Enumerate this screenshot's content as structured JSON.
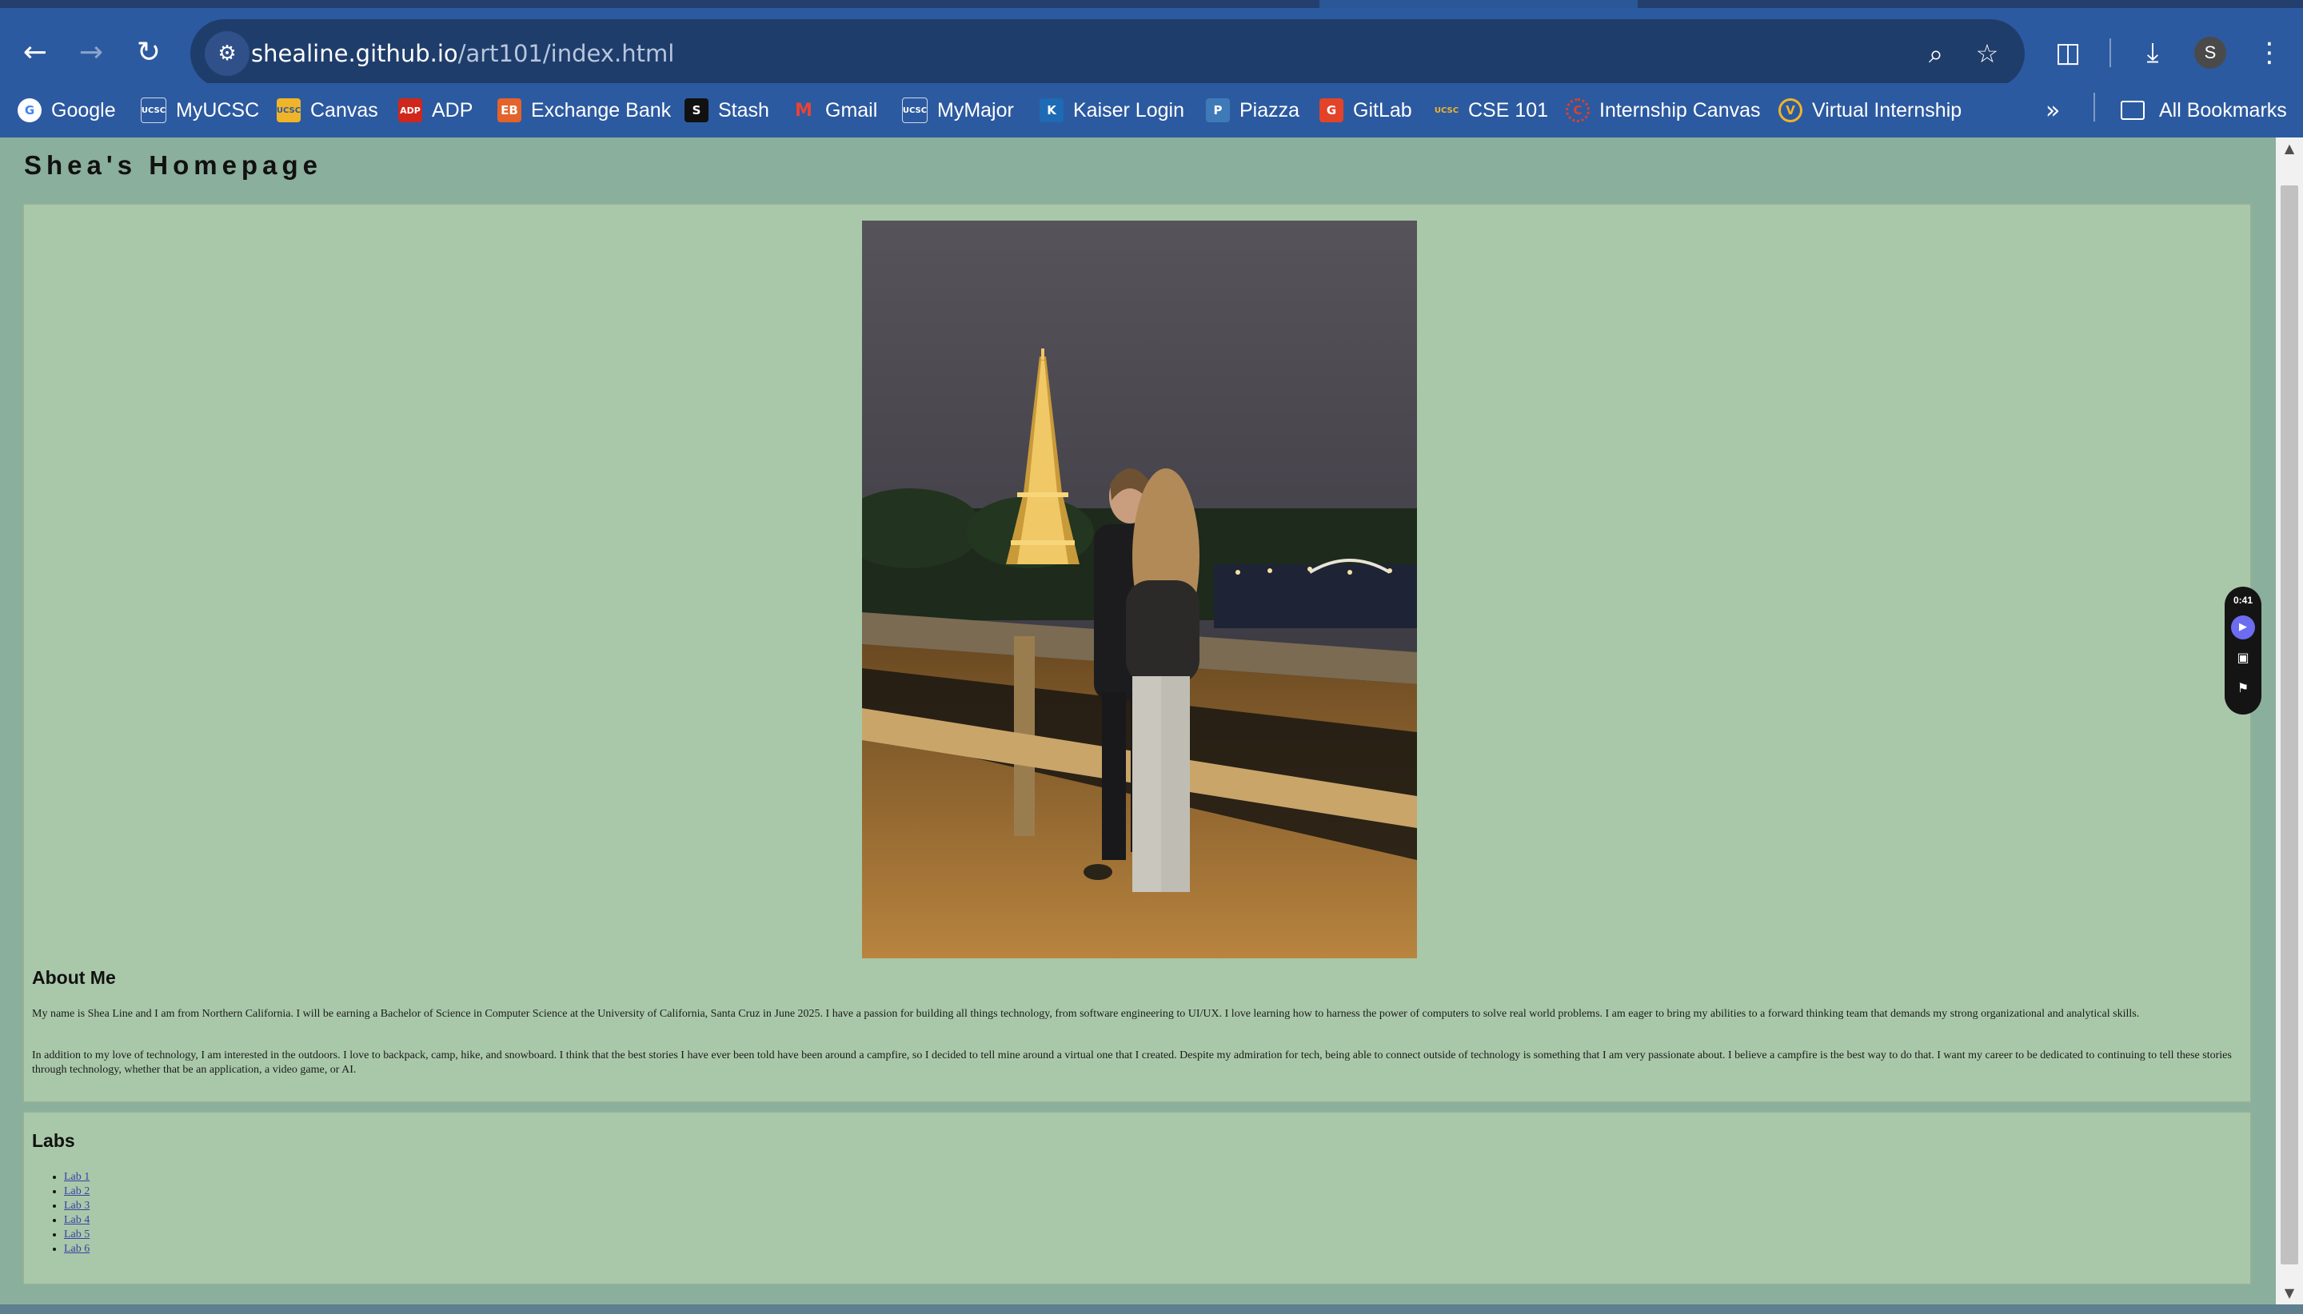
{
  "browser": {
    "back_icon": "arrow-left-icon",
    "forward_icon": "arrow-right-icon",
    "reload_icon": "reload-icon",
    "url_host": "shealine.github.io",
    "url_path": "/art101/index.html",
    "profile_initial": "S",
    "colors": {
      "toolbar": "#2c5aa0",
      "omnibox": "#1f3d6b"
    }
  },
  "bookmarks": {
    "items": [
      {
        "label": "Google",
        "icon": "google-icon",
        "glyph": "G",
        "color": "#ffffff"
      },
      {
        "label": "MyUCSC",
        "icon": "ucsc-icon",
        "glyph": "UCSC",
        "color": "#2c5aa0"
      },
      {
        "label": "Canvas",
        "icon": "ucsc-gold-icon",
        "glyph": "UCSC",
        "color": "#f0b429"
      },
      {
        "label": "ADP",
        "icon": "adp-icon",
        "glyph": "ADP",
        "color": "#d0271d"
      },
      {
        "label": "Exchange Bank",
        "icon": "exchange-bank-icon",
        "glyph": "EB",
        "color": "#e4632b"
      },
      {
        "label": "Stash",
        "icon": "stash-icon",
        "glyph": "S",
        "color": "#111111"
      },
      {
        "label": "Gmail",
        "icon": "gmail-icon",
        "glyph": "M",
        "color": "#ea4335"
      },
      {
        "label": "MyMajor",
        "icon": "ucsc-icon",
        "glyph": "UCSC",
        "color": "#2c5aa0"
      },
      {
        "label": "Kaiser Login",
        "icon": "kaiser-icon",
        "glyph": "K",
        "color": "#1e6ab5"
      },
      {
        "label": "Piazza",
        "icon": "piazza-icon",
        "glyph": "P",
        "color": "#3e7ab8"
      },
      {
        "label": "GitLab",
        "icon": "gitlab-icon",
        "glyph": "G",
        "color": "#e24329"
      },
      {
        "label": "CSE 101",
        "icon": "ucsc-gold-icon",
        "glyph": "UCSC",
        "color": "#c99a2e"
      },
      {
        "label": "Internship Canvas",
        "icon": "canvas-icon",
        "glyph": "C",
        "color": "#e13f2b"
      },
      {
        "label": "Virtual Internship",
        "icon": "virtual-internship-icon",
        "glyph": "V",
        "color": "#f0b429"
      }
    ],
    "overflow_icon": "chevron-double-right-icon",
    "all_bookmarks_label": "All Bookmarks"
  },
  "page": {
    "title": "Shea's Homepage",
    "photo_alt": "",
    "about": {
      "heading": "About Me",
      "paragraph1": "My name is Shea Line and I am from Northern California. I will be earning a Bachelor of Science in Computer Science at the University of California, Santa Cruz in June 2025. I have a passion for building all things technology, from software engineering to UI/UX. I love learning how to harness the power of computers to solve real world problems. I am eager to bring my abilities to a forward thinking team that demands my strong organizational and analytical skills.",
      "paragraph2": "In addition to my love of technology, I am interested in the outdoors. I love to backpack, camp, hike, and snowboard. I think that the best stories I have ever been told have been around a campfire, so I decided to tell mine around a virtual one that I created. Despite my admiration for tech, being able to connect outside of technology is something that I am very passionate about. I believe a campfire is the best way to do that. I want my career to be dedicated to continuing to tell these stories through technology, whether that be an application, a video game, or AI."
    },
    "labs": {
      "heading": "Labs",
      "items": [
        "Lab 1",
        "Lab 2",
        "Lab 3",
        "Lab 4",
        "Lab 5",
        "Lab 6"
      ]
    },
    "colors": {
      "background": "#8aaf9c",
      "panel": "#a9c8a9",
      "link": "#3b3fa3"
    }
  },
  "recorder": {
    "time": "0:41",
    "play_icon": "play-icon",
    "screenshot_icon": "capture-icon",
    "flag_icon": "flag-icon"
  }
}
